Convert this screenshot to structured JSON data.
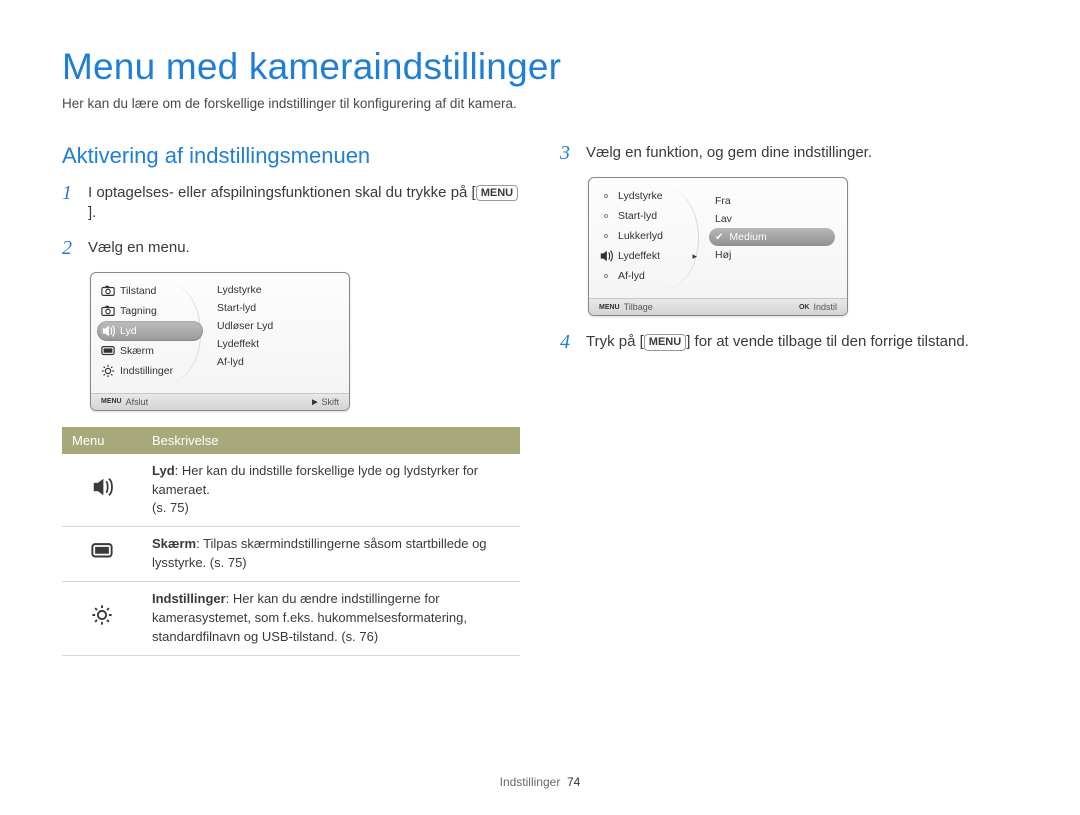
{
  "title": "Menu med kameraindstillinger",
  "intro": "Her kan du lære om de forskellige indstillinger til konfigurering af dit kamera.",
  "section_title": "Aktivering af indstillingsmenuen",
  "steps": {
    "s1": {
      "num": "1",
      "text_a": "I optagelses- eller afspilningsfunktionen skal du trykke på [",
      "text_b": "]."
    },
    "s2": {
      "num": "2",
      "text": "Vælg en menu."
    },
    "s3": {
      "num": "3",
      "text": "Vælg en funktion, og gem dine indstillinger."
    },
    "s4": {
      "num": "4",
      "text_a": "Tryk på [",
      "text_b": "] for at vende tilbage til den forrige tilstand."
    }
  },
  "menu_key": "MENU",
  "lcd1": {
    "left": [
      {
        "icon": "camera",
        "label": "Tilstand"
      },
      {
        "icon": "camera2",
        "label": "Tagning"
      },
      {
        "icon": "sound",
        "label": "Lyd",
        "selected": true
      },
      {
        "icon": "display",
        "label": "Skærm"
      },
      {
        "icon": "gear",
        "label": "Indstillinger"
      }
    ],
    "right": [
      "Lydstyrke",
      "Start-lyd",
      "Udløser Lyd",
      "Lydeffekt",
      "Af-lyd"
    ],
    "footer_left_key": "MENU",
    "footer_left": "Afslut",
    "footer_right_key": "▶",
    "footer_right": "Skift"
  },
  "lcd2": {
    "left": [
      {
        "label": "Lydstyrke",
        "marker": "dot"
      },
      {
        "label": "Start-lyd",
        "marker": "dot"
      },
      {
        "label": "Lukkerlyd",
        "marker": "dot"
      },
      {
        "label": "Lydeffekt",
        "marker": "sound",
        "pointer": true
      },
      {
        "label": "Af-lyd",
        "marker": "dot"
      }
    ],
    "right": [
      {
        "label": "Fra"
      },
      {
        "label": "Lav"
      },
      {
        "label": "Medium",
        "selected": true,
        "check": true
      },
      {
        "label": "Høj"
      }
    ],
    "footer_left_key": "MENU",
    "footer_left": "Tilbage",
    "footer_right_key": "OK",
    "footer_right": "Indstil"
  },
  "table": {
    "head_menu": "Menu",
    "head_desc": "Beskrivelse",
    "rows": [
      {
        "icon": "sound",
        "bold": "Lyd",
        "text": ": Her kan du indstille forskellige lyde og lydstyrker for kameraet.",
        "page": "(s. 75)"
      },
      {
        "icon": "display",
        "bold": "Skærm",
        "text": ": Tilpas skærmindstillingerne såsom startbillede og lysstyrke. (s. 75)",
        "page": ""
      },
      {
        "icon": "gear",
        "bold": "Indstillinger",
        "text": ": Her kan du ændre indstillingerne for kamerasystemet, som f.eks. hukommelsesformatering, standardfilnavn og USB-tilstand. (s. 76)",
        "page": ""
      }
    ]
  },
  "footer_section": "Indstillinger",
  "footer_page": "74"
}
